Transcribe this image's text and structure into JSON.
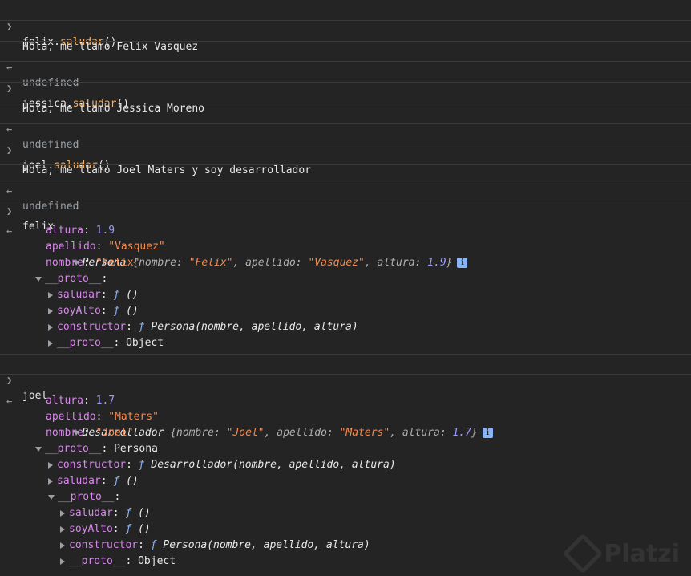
{
  "entries": {
    "e1": {
      "obj": "felix",
      "method": "saludar",
      "parens": "()"
    },
    "e2": {
      "output": "Hola, me llamo Felix Vasquez"
    },
    "e3": {
      "result": "undefined"
    },
    "e4": {
      "obj": "jessica",
      "method": "saludar",
      "parens": "()"
    },
    "e5": {
      "output": "Hola, me llamo Jessica Moreno"
    },
    "e6": {
      "result": "undefined"
    },
    "e7": {
      "obj": "joel",
      "method": "saludar",
      "parens": "()"
    },
    "e8": {
      "output": "Hola, me llamo Joel Maters y soy desarrollador"
    },
    "e9": {
      "result": "undefined"
    },
    "e10": {
      "input": "felix"
    },
    "e12": {
      "input": "joel"
    }
  },
  "felix_obj": {
    "summary_class": "Persona",
    "summary_nombre": "\"Felix\"",
    "summary_apellido": "\"Vasquez\"",
    "summary_altura": "1.9",
    "altura": "1.9",
    "apellido": "\"Vasquez\"",
    "nombre": "\"Felix\"",
    "proto_label": "__proto__",
    "saludar": "saludar",
    "soyAlto": "soyAlto",
    "constructor": "constructor",
    "constructor_sig": "Persona(nombre, apellido, altura)",
    "inner_proto": "__proto__",
    "inner_proto_val": "Object"
  },
  "joel_obj": {
    "summary_class": "Desarrollador",
    "summary_nombre": "\"Joel\"",
    "summary_apellido": "\"Maters\"",
    "summary_altura": "1.7",
    "altura": "1.7",
    "apellido": "\"Maters\"",
    "nombre": "\"Joel\"",
    "proto_label": "__proto__",
    "proto_val": "Persona",
    "constructor": "constructor",
    "constructor_sig": "Desarrollador(nombre, apellido, altura)",
    "saludar": "saludar",
    "proto2_label": "__proto__",
    "p2_saludar": "saludar",
    "p2_soyAlto": "soyAlto",
    "p2_constructor": "constructor",
    "p2_constructor_sig": "Persona(nombre, apellido, altura)",
    "p2_proto": "__proto__",
    "p2_proto_val": "Object"
  },
  "labels": {
    "nombre_key": "nombre",
    "apellido_key": "apellido",
    "altura_key": "altura",
    "f_glyph": "ƒ",
    "empty_parens": "()"
  },
  "watermark": {
    "text": "Platzi"
  },
  "colors": {
    "background": "#242424",
    "method": "#f1b16a",
    "key": "#d48ae6",
    "string": "#f28b54",
    "number": "#9e9bff",
    "function": "#8ab4f8"
  },
  "icons": {
    "input_prompt": "chevron-right-icon",
    "result_return": "return-arrow-icon",
    "expand_open": "triangle-down-icon",
    "expand_closed": "triangle-right-icon",
    "info": "info-icon"
  }
}
